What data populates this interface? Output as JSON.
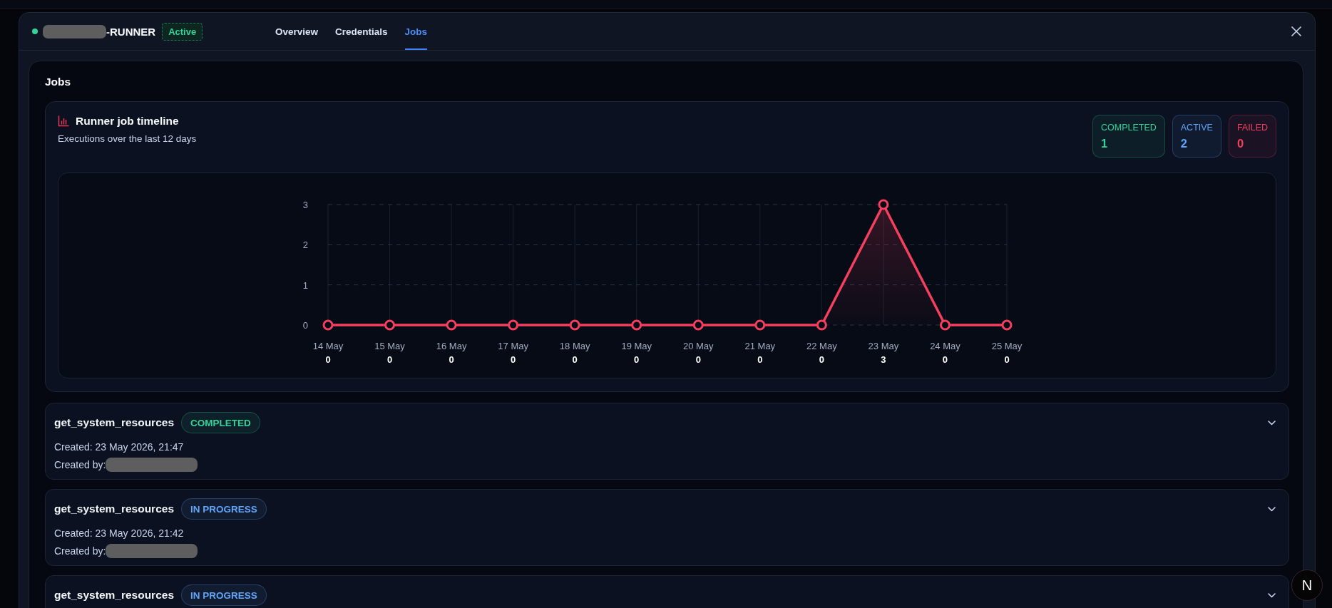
{
  "header": {
    "active": true,
    "title": "-RUNNER",
    "status": "Active",
    "tabs": [
      {
        "label": "Overview",
        "selected": false
      },
      {
        "label": "Credentials",
        "selected": false
      },
      {
        "label": "Jobs",
        "selected": true
      }
    ]
  },
  "panel": {
    "heading": "Jobs"
  },
  "timeline": {
    "title": "Runner job timeline",
    "subtitle": "Executions over the last 12 days",
    "stats": [
      {
        "label": "COMPLETED",
        "value": "1",
        "color": "#34d399"
      },
      {
        "label": "ACTIVE",
        "value": "2",
        "color": "#60a5fa"
      },
      {
        "label": "FAILED",
        "value": "0",
        "color": "#f43f5e"
      }
    ],
    "chart_data": {
      "type": "line",
      "categories": [
        "14 May",
        "15 May",
        "16 May",
        "17 May",
        "18 May",
        "19 May",
        "20 May",
        "21 May",
        "22 May",
        "23 May",
        "24 May",
        "25 May"
      ],
      "series": [
        {
          "color": "#f43f5e",
          "marker": true,
          "values": [
            0,
            0,
            0,
            0,
            0,
            0,
            0,
            0,
            0,
            3,
            0,
            0
          ]
        }
      ],
      "ylim": [
        0,
        3
      ],
      "yticks": [
        0,
        1,
        2,
        3
      ],
      "grid": true,
      "data_labels": true
    }
  },
  "jobs": [
    {
      "name": "get_system_resources",
      "badge": {
        "label": "COMPLETED",
        "color": "#34d399"
      },
      "created": "Created: 23 May 2026, 21:47",
      "created_by": "Created by:",
      "expanded": false
    },
    {
      "name": "get_system_resources",
      "badge": {
        "label": "IN PROGRESS",
        "color": "#60a5fa"
      },
      "created": "Created: 23 May 2026, 21:42",
      "created_by": "Created by:",
      "expanded": false
    },
    {
      "name": "get_system_resources",
      "badge": {
        "label": "IN PROGRESS",
        "color": "#60a5fa"
      },
      "expanded": false
    }
  ],
  "dev_indicator": {
    "label": "N"
  }
}
